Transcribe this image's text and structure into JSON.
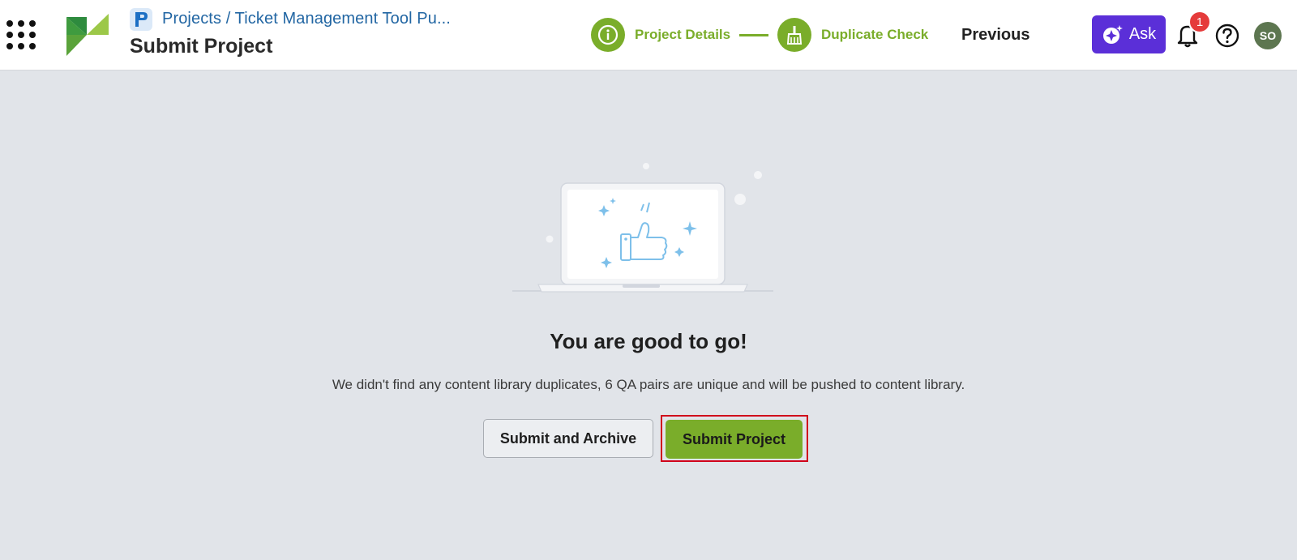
{
  "header": {
    "breadcrumb": "Projects / Ticket Management Tool Pu...",
    "page_title": "Submit Project",
    "steps": [
      {
        "label": "Project Details",
        "icon": "info-icon",
        "status": "complete"
      },
      {
        "label": "Duplicate Check",
        "icon": "broom-icon",
        "status": "complete"
      }
    ],
    "previous_label": "Previous",
    "ask_label": "Ask",
    "notification_count": "1",
    "avatar_initials": "SO"
  },
  "main": {
    "headline": "You are good to go!",
    "message": "We didn't find any content library duplicates, 6 QA pairs are unique and will be pushed to content library.",
    "secondary_button": "Submit and Archive",
    "primary_button": "Submit Project"
  },
  "colors": {
    "accent_green": "#7aad2a",
    "ask_purple": "#5b2fd8",
    "breadcrumb_blue": "#2266a3",
    "badge_red": "#e53b3b",
    "highlight_red": "#d0021b",
    "background": "#e1e4e9"
  }
}
